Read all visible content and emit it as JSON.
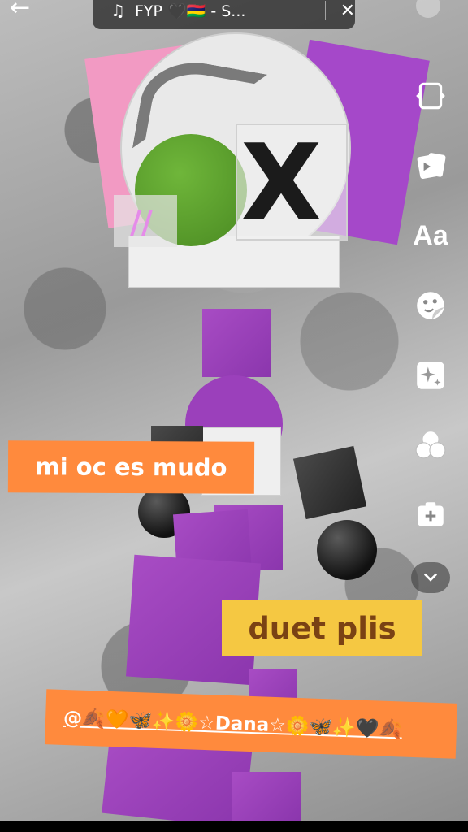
{
  "header": {
    "back_icon": "arrow-left-icon",
    "music_icon": "music-note-icon",
    "sound_title": "FYP 🖤🇲🇺 - S...",
    "close_symbol": "✕"
  },
  "toolbar": {
    "items": [
      {
        "name": "flip-icon"
      },
      {
        "name": "effects-icon"
      },
      {
        "label": "Aa"
      },
      {
        "name": "sticker-icon"
      },
      {
        "name": "sparkle-icon"
      },
      {
        "name": "filters-icon"
      },
      {
        "name": "add-clip-icon"
      },
      {
        "name": "chevron-down-icon"
      }
    ]
  },
  "stickers": {
    "sticker1": "mi oc es mudo",
    "sticker2": "duet plis",
    "sticker3": "@🍂🧡🦋✨🌼☆Dana☆🌼🦋✨🖤🍂"
  },
  "colors": {
    "orange": "#ff8a3d",
    "yellow": "#f5c842",
    "purple": "#9b40bb",
    "green": "#5b9b2e"
  }
}
